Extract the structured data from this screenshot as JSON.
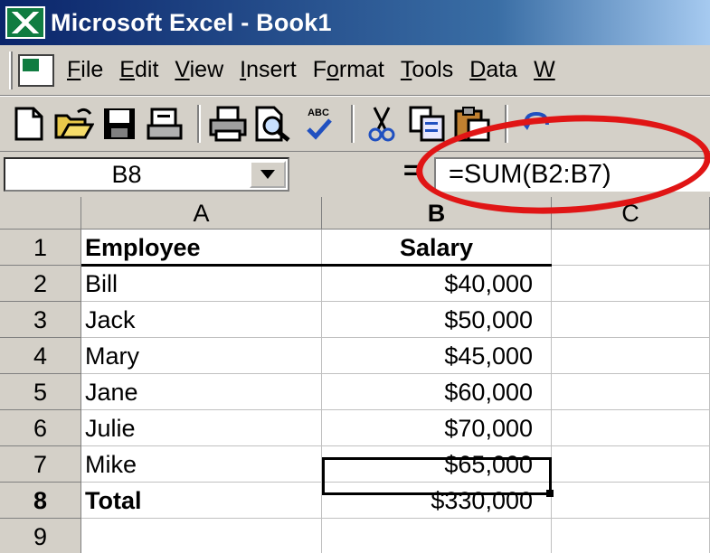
{
  "title_bar": {
    "title": "Microsoft Excel - Book1",
    "icon": "excel-icon"
  },
  "menu": {
    "items": [
      {
        "accel": "F",
        "rest": "ile"
      },
      {
        "accel": "E",
        "rest": "dit"
      },
      {
        "accel": "V",
        "rest": "iew"
      },
      {
        "accel": "I",
        "rest": "nsert"
      },
      {
        "pre": "F",
        "accel": "o",
        "rest": "rmat"
      },
      {
        "accel": "T",
        "rest": "ools"
      },
      {
        "accel": "D",
        "rest": "ata"
      },
      {
        "accel": "W",
        "rest": ""
      }
    ]
  },
  "toolbar": {
    "icons": [
      "new-icon",
      "open-icon",
      "save-icon",
      "permission-icon",
      "print-icon",
      "print-preview-icon",
      "spelling-icon",
      "cut-icon",
      "copy-icon",
      "paste-icon",
      "undo-icon"
    ],
    "spelling_text": "ABC"
  },
  "formula_bar": {
    "name_box": "B8",
    "equals": "=",
    "formula": "=SUM(B2:B7)"
  },
  "annotation_color": "#e01515",
  "sheet": {
    "columns": [
      "A",
      "B",
      "C"
    ],
    "active_cell": "B8",
    "rows": [
      {
        "num": "1",
        "a": "Employee",
        "b": "Salary",
        "bold": true
      },
      {
        "num": "2",
        "a": "Bill",
        "b": "$40,000"
      },
      {
        "num": "3",
        "a": "Jack",
        "b": "$50,000"
      },
      {
        "num": "4",
        "a": "Mary",
        "b": "$45,000"
      },
      {
        "num": "5",
        "a": "Jane",
        "b": "$60,000"
      },
      {
        "num": "6",
        "a": "Julie",
        "b": "$70,000"
      },
      {
        "num": "7",
        "a": "Mike",
        "b": "$65,000"
      },
      {
        "num": "8",
        "a": "Total",
        "b": "$330,000",
        "bold": true
      },
      {
        "num": "9",
        "a": "",
        "b": ""
      }
    ]
  }
}
